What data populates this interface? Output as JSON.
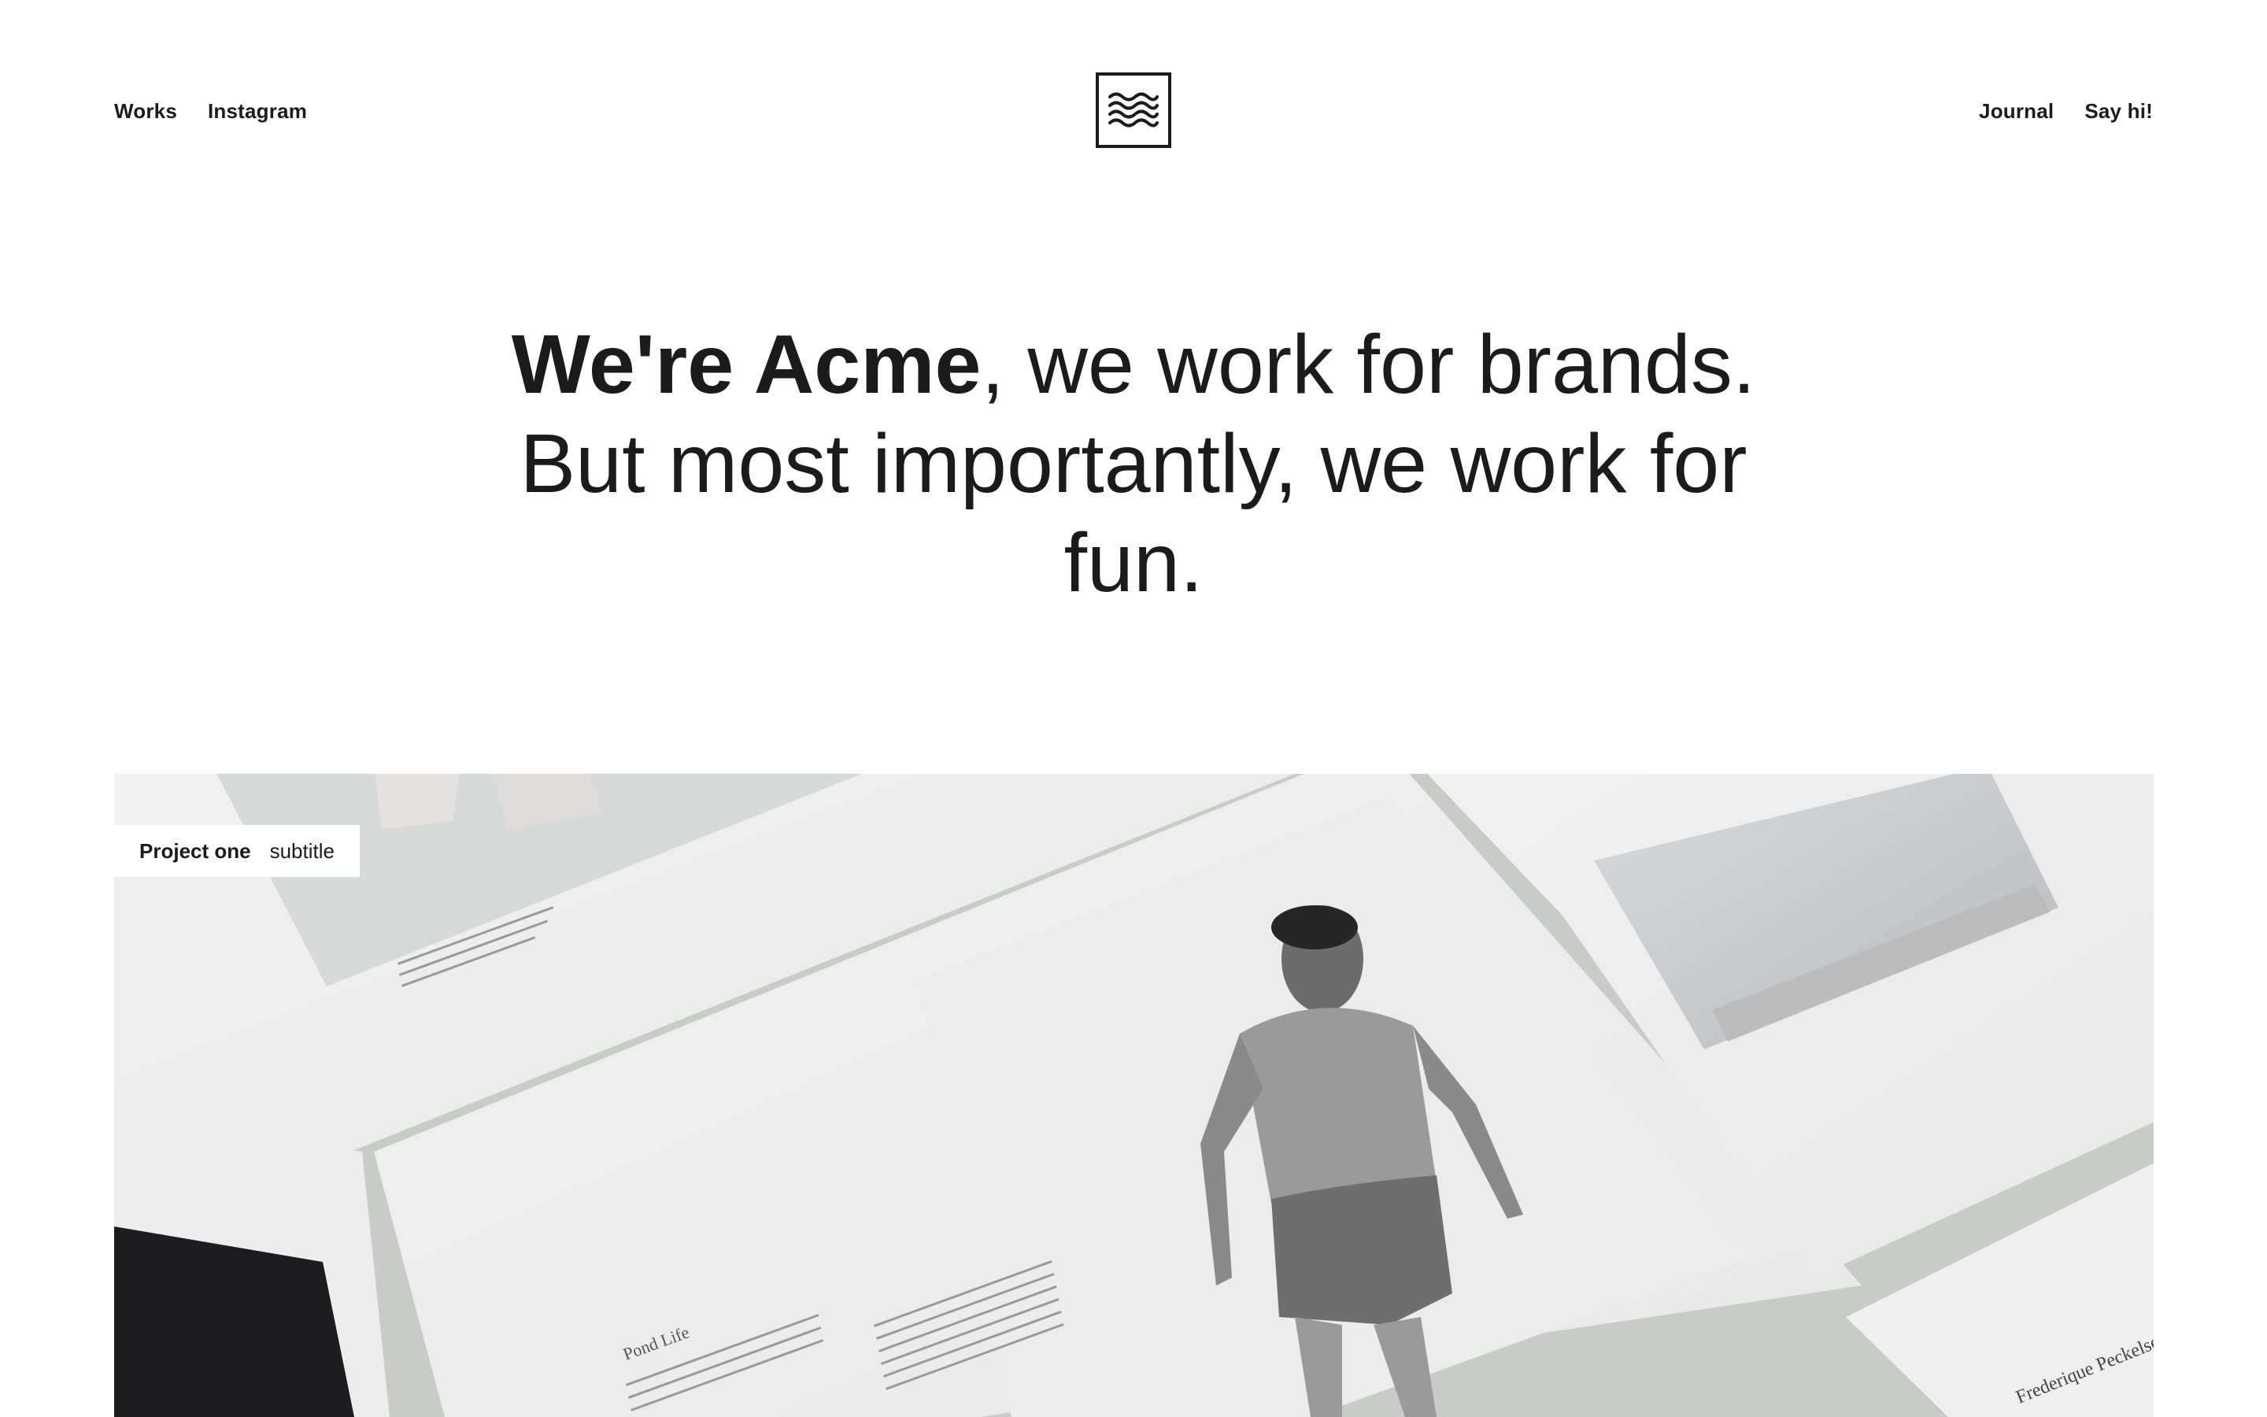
{
  "nav": {
    "left": [
      {
        "label": "Works"
      },
      {
        "label": "Instagram"
      }
    ],
    "right": [
      {
        "label": "Journal"
      },
      {
        "label": "Say hi!"
      }
    ],
    "logo_icon": "waves-icon"
  },
  "hero": {
    "line1_strong": "We're Acme",
    "line1_rest": ", we work for brands.",
    "line2": "But most importantly, we work for",
    "line3": "fun."
  },
  "project": {
    "title": "Project one",
    "subtitle": "subtitle",
    "image_text": {
      "pond_life": "Pond Life",
      "credit_name": "Frederique Peckelsen"
    }
  },
  "colors": {
    "text": "#1b1b1b",
    "background": "#ffffff",
    "paper": "#eeeeee"
  }
}
